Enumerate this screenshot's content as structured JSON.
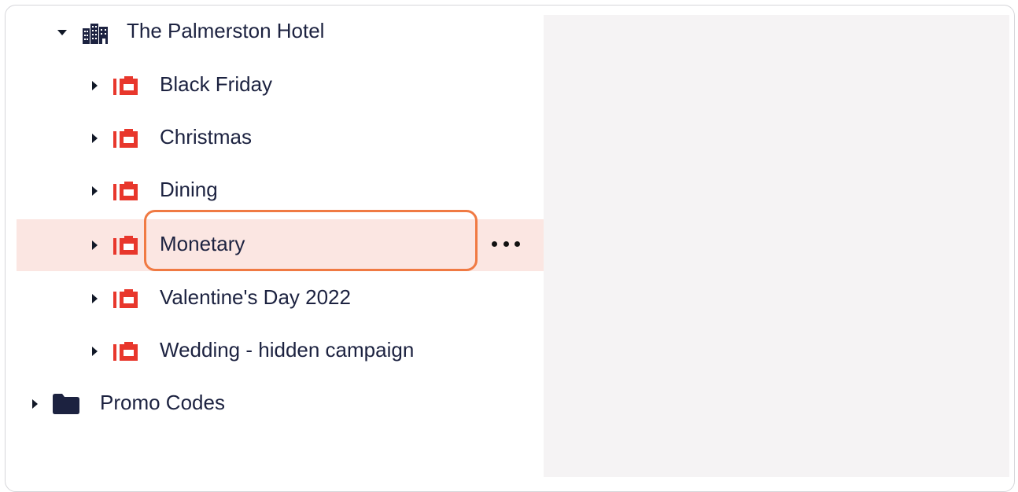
{
  "tree": {
    "root": {
      "label": "The Palmerston Hotel",
      "icon": "hotel-building-icon",
      "expanded": true
    },
    "campaigns": [
      {
        "label": "Black Friday",
        "icon": "campaign-icon",
        "selected": false
      },
      {
        "label": "Christmas",
        "icon": "campaign-icon",
        "selected": false
      },
      {
        "label": "Dining",
        "icon": "campaign-icon",
        "selected": false
      },
      {
        "label": "Monetary",
        "icon": "campaign-icon",
        "selected": true
      },
      {
        "label": "Valentine's Day 2022",
        "icon": "campaign-icon",
        "selected": false
      },
      {
        "label": "Wedding - hidden campaign",
        "icon": "campaign-icon",
        "selected": false
      }
    ],
    "promo": {
      "label": "Promo Codes",
      "icon": "folder-icon",
      "expanded": false
    },
    "row_actions": {
      "icon": "more-options-icon"
    }
  },
  "colors": {
    "selected_row_bg": "#fbe6e2",
    "highlight_border": "#f07a43",
    "campaign_icon": "#e8372c",
    "text": "#1c2240",
    "right_panel_bg": "#f5f3f4"
  }
}
